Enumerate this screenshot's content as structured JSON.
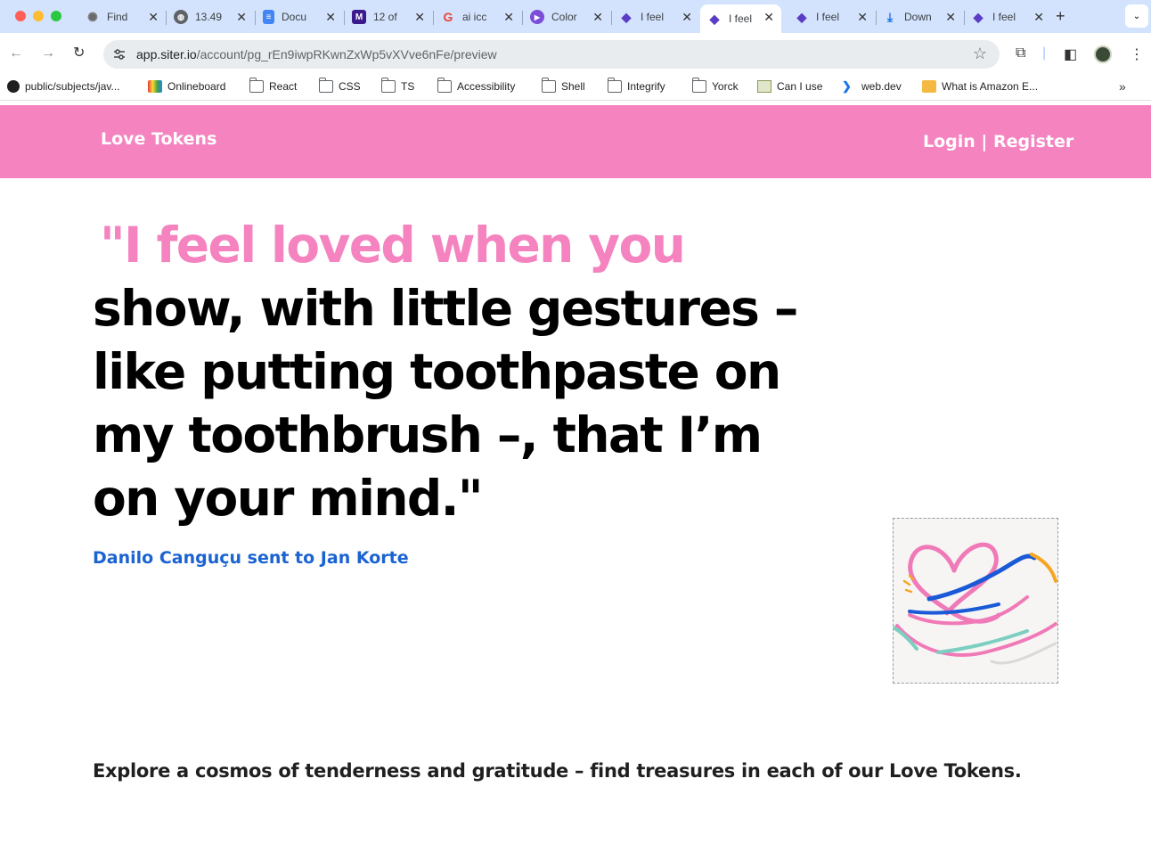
{
  "browser": {
    "tabs": [
      {
        "title": "Find",
        "icon": "chatgpt-icon",
        "color": "#6b6b6b"
      },
      {
        "title": "13.49",
        "icon": "globe-icon",
        "color": "#5f6368"
      },
      {
        "title": "Docu",
        "icon": "google-docs-icon",
        "color": "#4285f4"
      },
      {
        "title": "12 of",
        "icon": "m-icon",
        "color": "#3b1a8c"
      },
      {
        "title": "ai icc",
        "icon": "google-icon",
        "color": "#ea4335"
      },
      {
        "title": "Color",
        "icon": "play-icon",
        "color": "#7b4dd8"
      },
      {
        "title": "I feel",
        "icon": "siter-icon",
        "color": "#5b3cc4"
      },
      {
        "title": "I feel",
        "icon": "siter-icon",
        "color": "#5b3cc4",
        "active": true
      },
      {
        "title": "I feel",
        "icon": "siter-icon",
        "color": "#5b3cc4"
      },
      {
        "title": "Down",
        "icon": "download-icon",
        "color": "#1a73e8"
      },
      {
        "title": "I feel",
        "icon": "siter-icon",
        "color": "#5b3cc4"
      }
    ],
    "url_host": "app.siter.io",
    "url_path": "/account/pg_rEn9iwpRKwnZxWp5vXVve6nFe/preview",
    "bookmarks": [
      {
        "label": "public/subjects/jav...",
        "icon": "github-icon"
      },
      {
        "label": "Onlineboard",
        "icon": "onlineboard-icon"
      },
      {
        "label": "React",
        "icon": "folder-icon"
      },
      {
        "label": "CSS",
        "icon": "folder-icon"
      },
      {
        "label": "TS",
        "icon": "folder-icon"
      },
      {
        "label": "Accessibility",
        "icon": "folder-icon"
      },
      {
        "label": "Shell",
        "icon": "folder-icon"
      },
      {
        "label": "Integrify",
        "icon": "folder-icon"
      },
      {
        "label": "Yorck",
        "icon": "folder-icon"
      },
      {
        "label": "Can I use",
        "icon": "caniuse-icon"
      },
      {
        "label": "web.dev",
        "icon": "webdev-icon"
      },
      {
        "label": "What is Amazon E...",
        "icon": "aws-icon"
      }
    ]
  },
  "page": {
    "brand": "Love Tokens",
    "auth_label": "Login | Register",
    "quote_highlight": "\"I feel loved when you",
    "quote_rest": "show, with little gestures – like putting toothpaste on my toothbrush –, that I’m on your mind.\"",
    "sender_line": "Danilo Canguçu sent to Jan Korte",
    "tagline": "Explore a cosmos of tenderness and gratitude – find treasures in each of our Love Tokens.",
    "colors": {
      "accent": "#f483bf",
      "link": "#1a63d1"
    }
  }
}
